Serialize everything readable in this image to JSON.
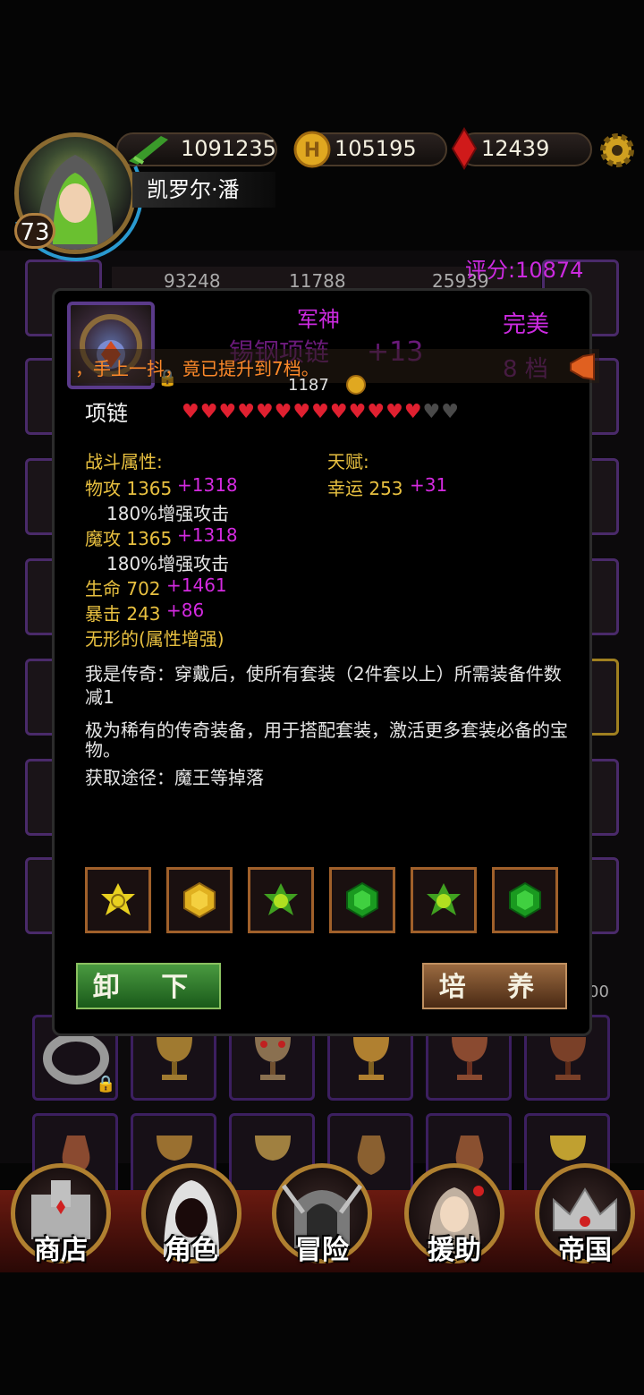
{
  "top_bar": {
    "power": "1091235",
    "gold": "105195",
    "gems": "12439",
    "player_name": "凯罗尔·潘",
    "level": "73"
  },
  "score_label": "评分:10874",
  "bg_stats": [
    "93248",
    "11788",
    "25939"
  ],
  "bg_inv_count": "00",
  "item": {
    "title": "军神",
    "name": "锡钢项链",
    "enhance": "+13",
    "quality": "完美",
    "tier": "8 档",
    "ticker": "，手上一抖，竟已提升到7档。",
    "gold_cost": "1187",
    "type": "项链",
    "hearts_filled": 13,
    "hearts_total": 15
  },
  "stats": {
    "combat_header": "战斗属性:",
    "talent_header": "天赋:",
    "phys_atk": "物攻 1365",
    "phys_atk_bonus": "+1318",
    "phys_atk_note": "180%增强攻击",
    "mag_atk": "魔攻 1365",
    "mag_atk_bonus": "+1318",
    "mag_atk_note": "180%增强攻击",
    "hp": "生命 702",
    "hp_bonus": "+1461",
    "crit": "暴击 243",
    "crit_bonus": "+86",
    "formless": "无形的(属性增强)",
    "luck": "幸运 253",
    "luck_bonus": "+31"
  },
  "legend_text": "我是传奇：穿戴后，使所有套装（2件套以上）所需装备件数减1",
  "description": "极为稀有的传奇装备，用于搭配套装，激活更多套装必备的宝物。",
  "source": "获取途径：魔王等掉落",
  "gems": [
    "yellow-star-gem",
    "yellow-hex-gem",
    "green-star-gem",
    "green-hex-gem",
    "green-star-gem",
    "green-hex-gem"
  ],
  "buttons": {
    "unequip": "卸 下",
    "cultivate": "培 养"
  },
  "nav": [
    "商店",
    "角色",
    "冒险",
    "援助",
    "帝国"
  ],
  "colors": {
    "purple": "#cc2ae0",
    "gold": "#e8c040",
    "heart_red": "#e02030"
  }
}
